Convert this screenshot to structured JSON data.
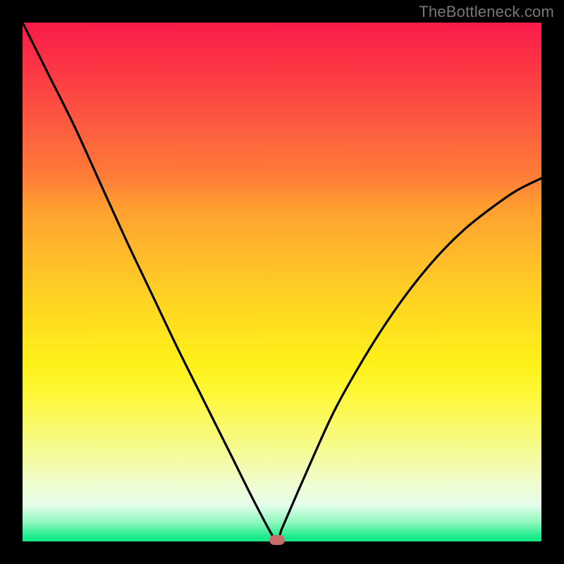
{
  "watermark": "TheBottleneck.com",
  "colors": {
    "frame": "#000000",
    "gradient_top": "#fa1b49",
    "gradient_mid": "#ffd024",
    "gradient_bottom": "#18e888",
    "curve": "#000000",
    "marker": "#c86d6a"
  },
  "chart_data": {
    "type": "line",
    "title": "",
    "xlabel": "",
    "ylabel": "",
    "xlim": [
      0,
      100
    ],
    "ylim": [
      0,
      100
    ],
    "series": [
      {
        "name": "bottleneck-curve",
        "x": [
          0,
          5,
          10,
          15,
          20,
          25,
          30,
          35,
          40,
          45,
          49,
          50,
          55,
          60,
          65,
          70,
          75,
          80,
          85,
          90,
          95,
          100
        ],
        "values": [
          100,
          90,
          80,
          69,
          58,
          47.5,
          37,
          27,
          17,
          7,
          0,
          2.5,
          14,
          25,
          34,
          42,
          49,
          55,
          60,
          64,
          67.5,
          70
        ]
      }
    ],
    "marker": {
      "x": 49,
      "y": 0
    },
    "annotations": []
  }
}
